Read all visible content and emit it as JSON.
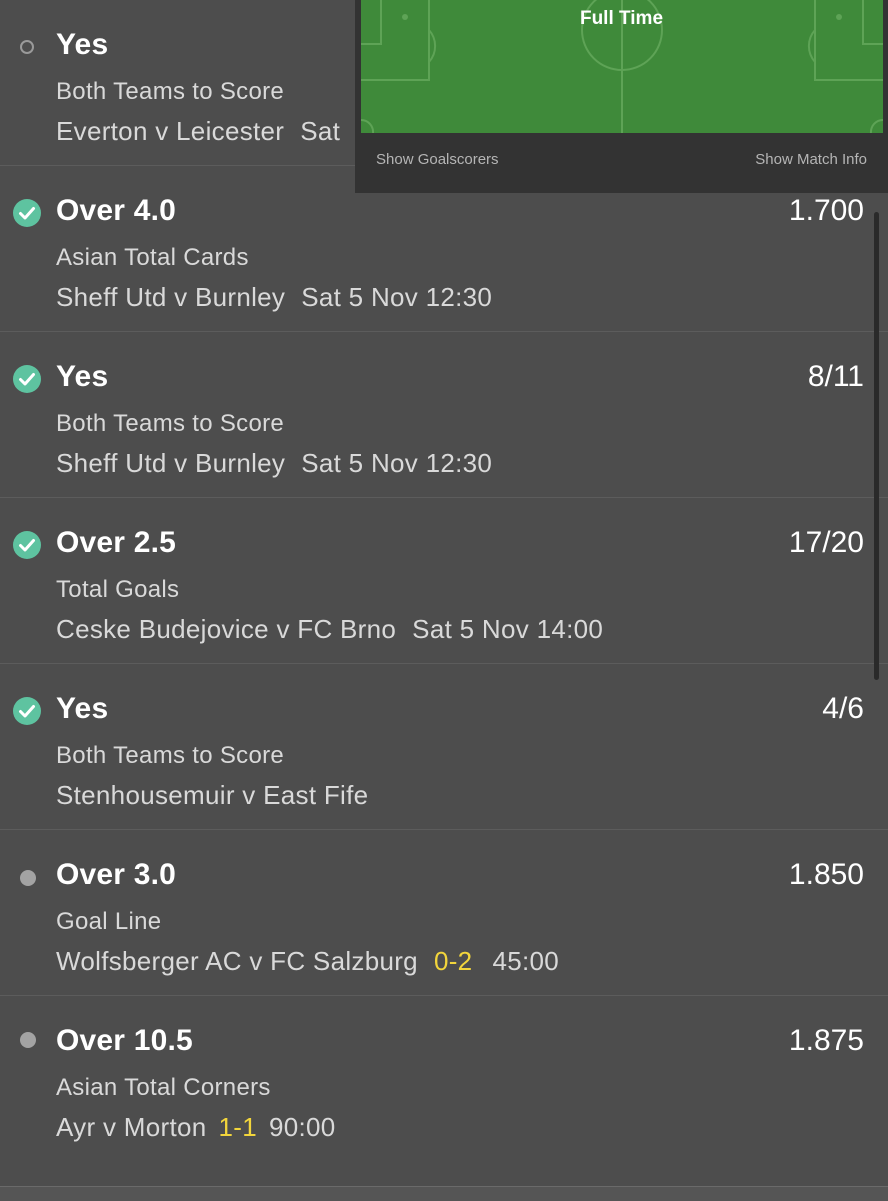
{
  "colors": {
    "background": "#4d4d4d",
    "won": "#5ec3a0",
    "score": "#f2d53c",
    "pitch": "#3f8a3a"
  },
  "tracker": {
    "status": "Full Time",
    "show_goalscorers": "Show Goalscorers",
    "show_match_info": "Show Match Info"
  },
  "legs": [
    {
      "status": "pending",
      "selection": "Yes",
      "market": "Both Teams to Score",
      "event": "Everton v Leicester",
      "kickoff": "Sat",
      "odds": ""
    },
    {
      "status": "won",
      "selection": "Over 4.0",
      "market": "Asian Total Cards",
      "event": "Sheff Utd v Burnley",
      "kickoff": "Sat 5 Nov 12:30",
      "odds": "1.700"
    },
    {
      "status": "won",
      "selection": "Yes",
      "market": "Both Teams to Score",
      "event": "Sheff Utd v Burnley",
      "kickoff": "Sat 5 Nov 12:30",
      "odds": "8/11"
    },
    {
      "status": "won",
      "selection": "Over 2.5",
      "market": "Total Goals",
      "event": "Ceske Budejovice v FC Brno",
      "kickoff": "Sat 5 Nov 14:00",
      "odds": "17/20"
    },
    {
      "status": "won",
      "selection": "Yes",
      "market": "Both Teams to Score",
      "event": "Stenhousemuir v East Fife",
      "kickoff": "",
      "odds": "4/6"
    },
    {
      "status": "live",
      "selection": "Over 3.0",
      "market": "Goal Line",
      "event": "Wolfsberger AC v FC Salzburg",
      "score": "0-2",
      "clock": "45:00",
      "odds": "1.850"
    },
    {
      "status": "live",
      "selection": "Over 10.5",
      "market": "Asian Total Corners",
      "event": "Ayr v Morton",
      "score": "1-1",
      "clock": "90:00",
      "odds": "1.875"
    }
  ]
}
